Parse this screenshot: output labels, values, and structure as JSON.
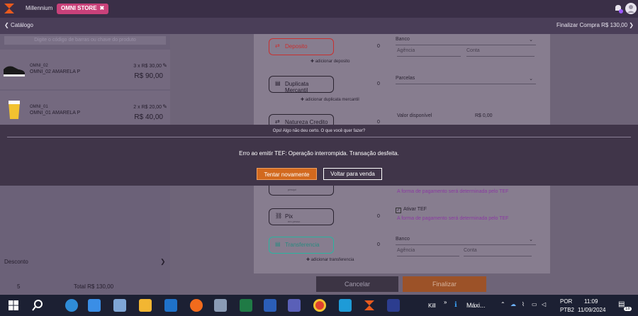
{
  "topbar": {
    "app_tab": "Millennium",
    "store_tab": "OMNI STORE",
    "close": "✖"
  },
  "subbar": {
    "back_label": "Catálogo",
    "checkout_label": "Finalizar Compra  R$ 130,00"
  },
  "cart": {
    "search_placeholder": "Digite o código de barras ou chave do produto",
    "items": [
      {
        "code": "OMNI_02",
        "description": "OMNI_02 AMARELA P",
        "qty_price": "3 x R$ 30,00",
        "total": "R$ 90,00"
      },
      {
        "code": "OMNI_01",
        "description": "OMNI_01 AMARELA P",
        "qty_price": "2 x R$ 20,00",
        "total": "R$ 40,00"
      }
    ],
    "discount_label": "Desconto",
    "item_count": "5",
    "grand_total": "Total R$ 130,00"
  },
  "payments": {
    "deposito": {
      "label": "Deposito",
      "value": "0",
      "add": "adicionar deposito",
      "bank": "Banco",
      "agency": "Agência",
      "account": "Conta"
    },
    "duplicata": {
      "label": "Duplicata Mercantil",
      "value": "0",
      "add": "adicionar duplicata mercantil",
      "parcelas": "Parcelas"
    },
    "natureza": {
      "label": "Natureza Credito",
      "value": "0",
      "available_label": "Valor disponível",
      "available_value": "R$ 0,00"
    },
    "tef_info": "A forma de pagamento será determinada pelo TEF",
    "pix": {
      "label": "Pix",
      "sub": "em pesso",
      "value": "0",
      "tef_toggle": "Ativar TEF",
      "info": "A forma de pagamento será determinada pelo TEF"
    },
    "transferencia": {
      "label": "Transferencia",
      "value": "0",
      "add": "adicionar transferencia",
      "bank": "Banco",
      "agency": "Agência",
      "account": "Conta"
    },
    "other_sub": "pesqui"
  },
  "actions": {
    "cancel": "Cancelar",
    "finish": "Finalizar"
  },
  "modal": {
    "title": "Ops! Algo não deu certo. O que você quer fazer?",
    "message": "Erro ao emitir TEF: Operação interrompida. Transação desfeita.",
    "retry": "Tentar novamente",
    "back": "Voltar para venda"
  },
  "taskbar": {
    "kill_label": "Kill",
    "chevrons": "»",
    "max_label": "Máxi...",
    "lang": "POR",
    "layout": "PTB2",
    "time": "11:09",
    "date": "11/09/2024",
    "notif_count": "18"
  },
  "colors": {
    "accent": "#d2691e",
    "brand": "#c9417a",
    "modal_bg": "#403549"
  }
}
